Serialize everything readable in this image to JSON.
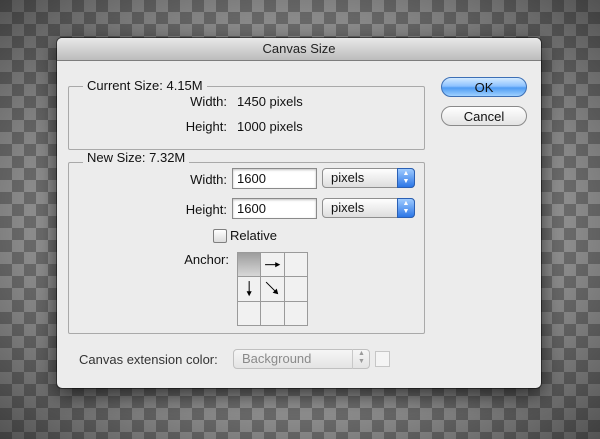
{
  "dialog": {
    "title": "Canvas Size",
    "current_size": {
      "legend": "Current Size: 4.15M",
      "width_label": "Width:",
      "width_value": "1450 pixels",
      "height_label": "Height:",
      "height_value": "1000 pixels"
    },
    "new_size": {
      "legend": "New Size: 7.32M",
      "width_label": "Width:",
      "width_value": "1600",
      "width_unit": "pixels",
      "height_label": "Height:",
      "height_value": "1600",
      "height_unit": "pixels",
      "relative_label": "Relative",
      "relative_checked": false,
      "anchor_label": "Anchor:",
      "anchor_selected": "top-left"
    },
    "extension": {
      "label": "Canvas extension color:",
      "value": "Background"
    },
    "buttons": {
      "ok": "OK",
      "cancel": "Cancel"
    }
  },
  "colors": {
    "ok_button": "#6aaef5",
    "dialog_bg": "#ececec",
    "popup_accent": "#2c76e6"
  }
}
